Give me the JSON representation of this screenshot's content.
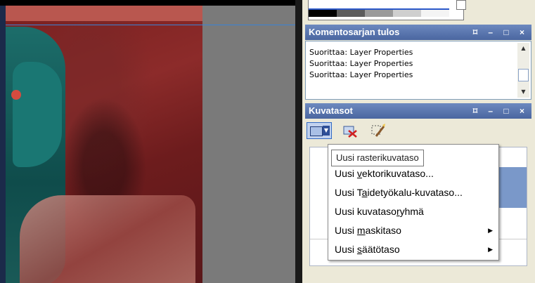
{
  "command_panel": {
    "title": "Komentosarjan tulos",
    "lines": [
      "Suorittaa: Layer Properties",
      "Suorittaa: Layer Properties",
      "Suorittaa: Layer Properties"
    ],
    "controls": "⌑ – □ ×"
  },
  "layers_panel": {
    "title": "Kuvatasot",
    "controls": "⌑ – □ ×"
  },
  "tooltip": "Uusi rasterikuvataso",
  "menu": {
    "items": [
      {
        "pre": "Uusi ",
        "key": "v",
        "post": "ektorikuvataso...",
        "submenu": false
      },
      {
        "pre": "Uusi T",
        "key": "a",
        "post": "idetyökalu-kuvataso...",
        "submenu": false
      },
      {
        "pre": "Uusi kuvataso",
        "key": "r",
        "post": "yhmä",
        "submenu": false
      },
      {
        "pre": "Uusi ",
        "key": "m",
        "post": "askitaso",
        "submenu": true
      },
      {
        "pre": "Uusi ",
        "key": "s",
        "post": "äätötaso",
        "submenu": true
      }
    ],
    "submenu_arrow": "▶"
  },
  "icons": {
    "new_layer": "new-raster-layer-icon",
    "delete_layer": "delete-layer-icon",
    "layer_properties": "layer-properties-icon"
  },
  "colors": {
    "title_bar": "#4a66a0",
    "selection": "#7a98c9"
  }
}
